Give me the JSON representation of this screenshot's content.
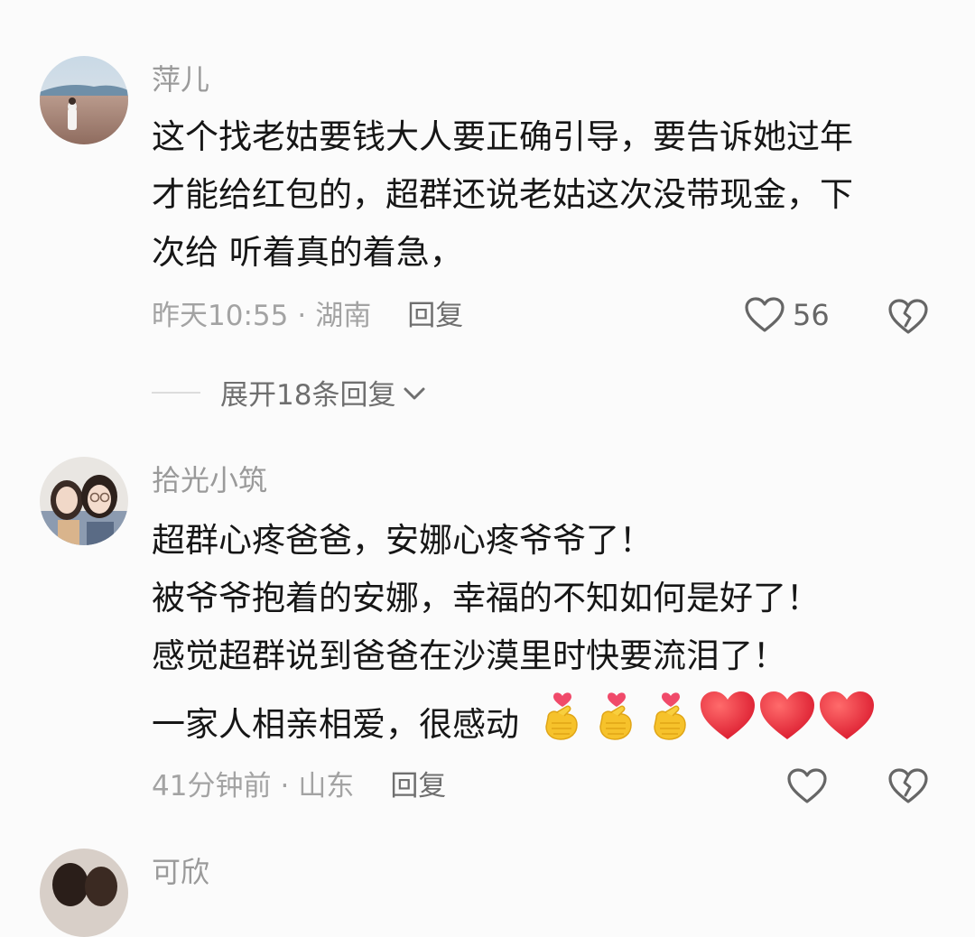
{
  "comments": [
    {
      "username": "萍儿",
      "lines": [
        "这个找老姑要钱大人要正确引导，要告诉她过年",
        "才能给红包的，超群还说老姑这次没带现金，下",
        "次给 听着真的着急，"
      ],
      "time": "昨天10:55",
      "separator": "·",
      "location": "湖南",
      "reply_label": "回复",
      "like_count": "56",
      "expand_label": "展开18条回复"
    },
    {
      "username": "拾光小筑",
      "lines": [
        "超群心疼爸爸，安娜心疼爷爷了！",
        "被爷爷抱着的安娜，幸福的不知如何是好了！",
        "感觉超群说到爸爸在沙漠里时快要流泪了！",
        "一家人相亲相爱，很感动"
      ],
      "emojis": [
        "finger-heart",
        "finger-heart",
        "finger-heart",
        "red-heart",
        "red-heart",
        "red-heart"
      ],
      "time": "41分钟前",
      "separator": "·",
      "location": "山东",
      "reply_label": "回复"
    },
    {
      "username": "可欣"
    }
  ],
  "colors": {
    "background": "#fbfbfb",
    "username": "#9a9a9a",
    "content": "#161616",
    "meta": "#a3a3a3",
    "heart_red": "#e8283a"
  }
}
